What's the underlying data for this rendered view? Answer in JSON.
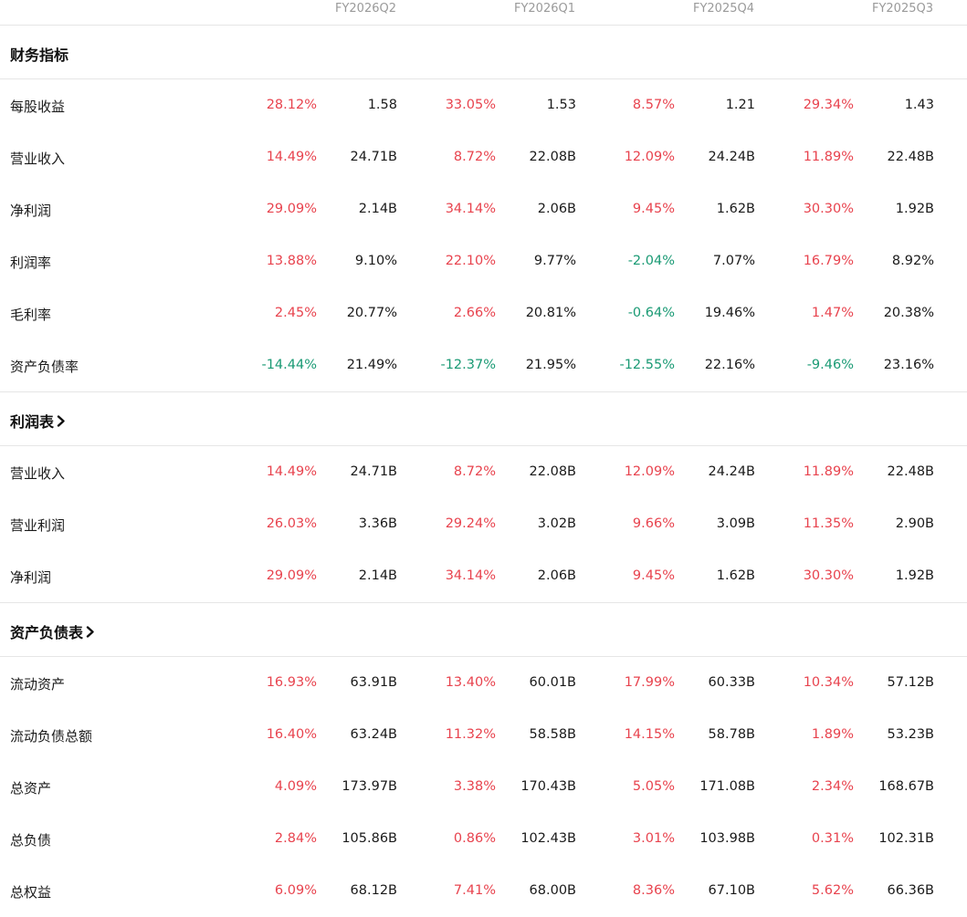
{
  "periods": [
    "FY2026Q2",
    "FY2026Q1",
    "FY2025Q4",
    "FY2025Q3"
  ],
  "sections": [
    {
      "title": "财务指标",
      "has_link": false,
      "rows": [
        {
          "label": "每股收益",
          "cells": [
            [
              "28.12%",
              "1.58"
            ],
            [
              "33.05%",
              "1.53"
            ],
            [
              "8.57%",
              "1.21"
            ],
            [
              "29.34%",
              "1.43"
            ]
          ]
        },
        {
          "label": "营业收入",
          "cells": [
            [
              "14.49%",
              "24.71B"
            ],
            [
              "8.72%",
              "22.08B"
            ],
            [
              "12.09%",
              "24.24B"
            ],
            [
              "11.89%",
              "22.48B"
            ]
          ]
        },
        {
          "label": "净利润",
          "cells": [
            [
              "29.09%",
              "2.14B"
            ],
            [
              "34.14%",
              "2.06B"
            ],
            [
              "9.45%",
              "1.62B"
            ],
            [
              "30.30%",
              "1.92B"
            ]
          ]
        },
        {
          "label": "利润率",
          "cells": [
            [
              "13.88%",
              "9.10%"
            ],
            [
              "22.10%",
              "9.77%"
            ],
            [
              "-2.04%",
              "7.07%"
            ],
            [
              "16.79%",
              "8.92%"
            ]
          ]
        },
        {
          "label": "毛利率",
          "cells": [
            [
              "2.45%",
              "20.77%"
            ],
            [
              "2.66%",
              "20.81%"
            ],
            [
              "-0.64%",
              "19.46%"
            ],
            [
              "1.47%",
              "20.38%"
            ]
          ]
        },
        {
          "label": "资产负债率",
          "cells": [
            [
              "-14.44%",
              "21.49%"
            ],
            [
              "-12.37%",
              "21.95%"
            ],
            [
              "-12.55%",
              "22.16%"
            ],
            [
              "-9.46%",
              "23.16%"
            ]
          ]
        }
      ]
    },
    {
      "title": "利润表",
      "has_link": true,
      "rows": [
        {
          "label": "营业收入",
          "cells": [
            [
              "14.49%",
              "24.71B"
            ],
            [
              "8.72%",
              "22.08B"
            ],
            [
              "12.09%",
              "24.24B"
            ],
            [
              "11.89%",
              "22.48B"
            ]
          ]
        },
        {
          "label": "营业利润",
          "cells": [
            [
              "26.03%",
              "3.36B"
            ],
            [
              "29.24%",
              "3.02B"
            ],
            [
              "9.66%",
              "3.09B"
            ],
            [
              "11.35%",
              "2.90B"
            ]
          ]
        },
        {
          "label": "净利润",
          "cells": [
            [
              "29.09%",
              "2.14B"
            ],
            [
              "34.14%",
              "2.06B"
            ],
            [
              "9.45%",
              "1.62B"
            ],
            [
              "30.30%",
              "1.92B"
            ]
          ]
        }
      ]
    },
    {
      "title": "资产负债表",
      "has_link": true,
      "rows": [
        {
          "label": "流动资产",
          "cells": [
            [
              "16.93%",
              "63.91B"
            ],
            [
              "13.40%",
              "60.01B"
            ],
            [
              "17.99%",
              "60.33B"
            ],
            [
              "10.34%",
              "57.12B"
            ]
          ]
        },
        {
          "label": "流动负债总额",
          "cells": [
            [
              "16.40%",
              "63.24B"
            ],
            [
              "11.32%",
              "58.58B"
            ],
            [
              "14.15%",
              "58.78B"
            ],
            [
              "1.89%",
              "53.23B"
            ]
          ]
        },
        {
          "label": "总资产",
          "cells": [
            [
              "4.09%",
              "173.97B"
            ],
            [
              "3.38%",
              "170.43B"
            ],
            [
              "5.05%",
              "171.08B"
            ],
            [
              "2.34%",
              "168.67B"
            ]
          ]
        },
        {
          "label": "总负债",
          "cells": [
            [
              "2.84%",
              "105.86B"
            ],
            [
              "0.86%",
              "102.43B"
            ],
            [
              "3.01%",
              "103.98B"
            ],
            [
              "0.31%",
              "102.31B"
            ]
          ]
        },
        {
          "label": "总权益",
          "cells": [
            [
              "6.09%",
              "68.12B"
            ],
            [
              "7.41%",
              "68.00B"
            ],
            [
              "8.36%",
              "67.10B"
            ],
            [
              "5.62%",
              "66.36B"
            ]
          ]
        }
      ]
    }
  ],
  "colors": {
    "up": "#e8434e",
    "down": "#1a9a74",
    "period": "#9a9a9a"
  },
  "icons": {
    "section_link": "chevron-right-icon"
  }
}
